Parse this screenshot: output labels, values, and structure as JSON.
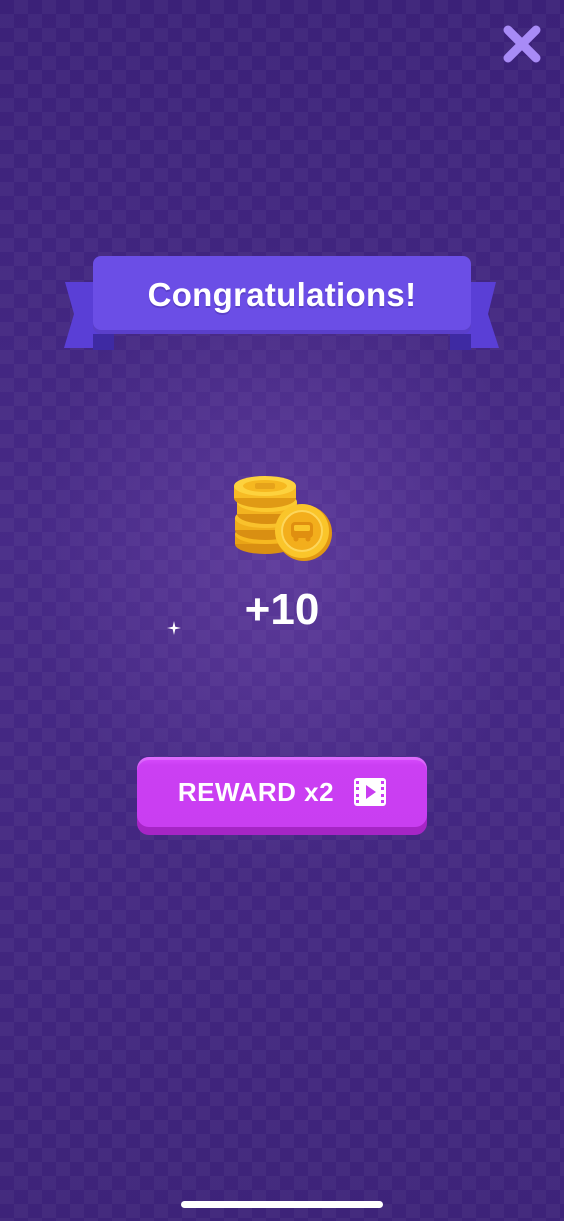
{
  "dialog": {
    "title": "Congratulations!",
    "reward_amount": "+10",
    "reward_button_label": "REWARD x2",
    "reward_button_icon": "video-ad-icon",
    "reward_icon": "coin-stack-icon",
    "close_icon": "close-icon"
  },
  "colors": {
    "background": "#43287f",
    "banner": "#6b4ee6",
    "banner_tail": "#4b32c4",
    "button": "#c93ef1",
    "close": "#a88bf6",
    "coin": "#f6b820"
  }
}
